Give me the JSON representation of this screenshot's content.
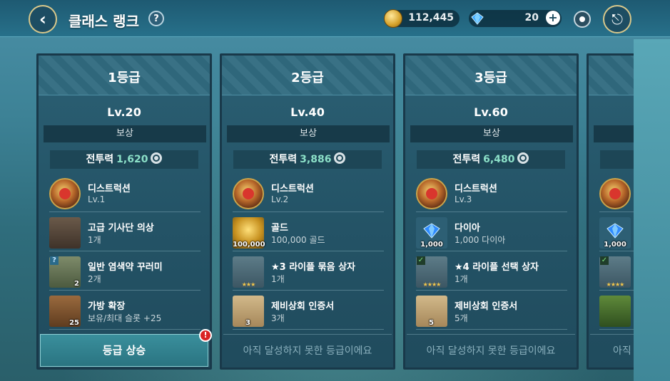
{
  "header": {
    "title": "클래스 랭크",
    "help_label": "?",
    "gold_amount": "112,445",
    "diamond_amount": "20",
    "plus_label": "+"
  },
  "cards": [
    {
      "grade": "1등급",
      "level": "Lv.20",
      "reward_label": "보상",
      "power_label": "전투력",
      "power_value": "1,620",
      "items": [
        {
          "name": "디스트럭션",
          "sub": "Lv.1",
          "icon": "destruction-emblem-icon",
          "badge": ""
        },
        {
          "name": "고급 기사단 의상",
          "sub": "1개",
          "icon": "knight-armor-icon",
          "badge": ""
        },
        {
          "name": "일반 염색약 꾸러미",
          "sub": "2개",
          "icon": "dye-bundle-icon",
          "badge": "2"
        },
        {
          "name": "가방 확장",
          "sub": "보유/최대 슬롯 +25",
          "icon": "bag-icon",
          "badge": "25"
        }
      ],
      "action_label": "등급 상승",
      "alert_label": "!"
    },
    {
      "grade": "2등급",
      "level": "Lv.40",
      "reward_label": "보상",
      "power_label": "전투력",
      "power_value": "3,886",
      "items": [
        {
          "name": "디스트럭션",
          "sub": "Lv.2",
          "icon": "destruction-emblem-icon",
          "badge": ""
        },
        {
          "name": "골드",
          "sub": "100,000 골드",
          "icon": "gold-coin-icon",
          "badge": "100,000"
        },
        {
          "name": "★3 라이플 묶음 상자",
          "sub": "1개",
          "icon": "rifle-box-icon",
          "badge": "★★★"
        },
        {
          "name": "제비상회 인증서",
          "sub": "3개",
          "icon": "certificate-scroll-icon",
          "badge": "3"
        }
      ],
      "locked_label": "아직 달성하지 못한 등급이에요"
    },
    {
      "grade": "3등급",
      "level": "Lv.60",
      "reward_label": "보상",
      "power_label": "전투력",
      "power_value": "6,480",
      "items": [
        {
          "name": "디스트럭션",
          "sub": "Lv.3",
          "icon": "destruction-emblem-icon",
          "badge": ""
        },
        {
          "name": "다이아",
          "sub": "1,000 다이아",
          "icon": "diamond-icon",
          "badge": "1,000"
        },
        {
          "name": "★4 라이플 선택 상자",
          "sub": "1개",
          "icon": "rifle-select-box-icon",
          "badge": "★★★★"
        },
        {
          "name": "제비상회 인증서",
          "sub": "5개",
          "icon": "certificate-scroll-icon",
          "badge": "5"
        }
      ],
      "locked_label": "아직 달성하지 못한 등급이에요"
    },
    {
      "diamond_badge": "1,000",
      "stars": "★★★★",
      "locked_label": "아직 달"
    }
  ]
}
